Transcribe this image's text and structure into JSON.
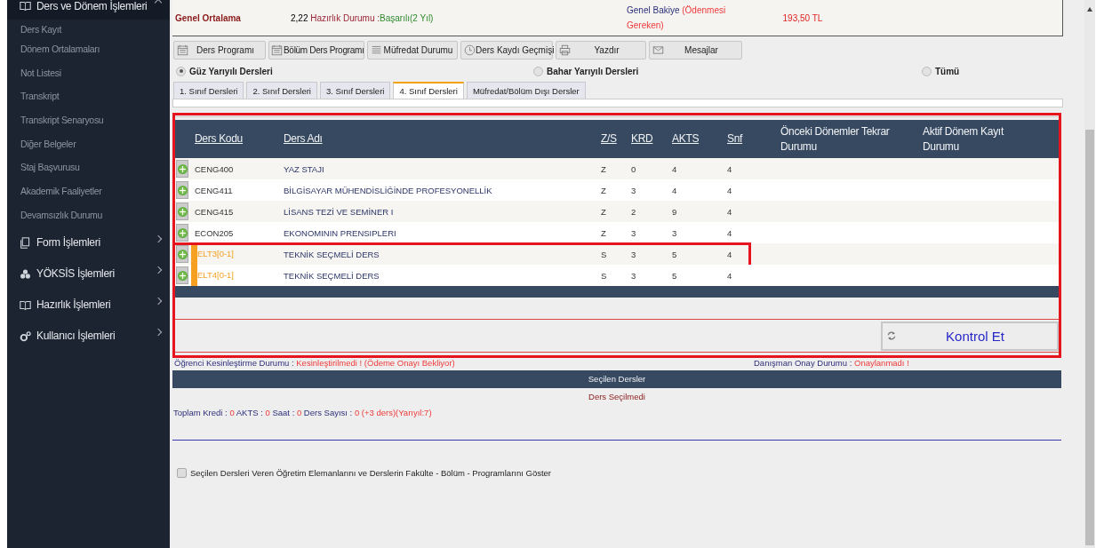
{
  "sidebar": {
    "groups": [
      {
        "label": "Ders ve Dönem İşlemleri",
        "expanded": true,
        "items": [
          "Ders Kayıt",
          "Dönem Ortalamaları",
          "Not Listesi",
          "Transkript",
          "Transkript Senaryosu",
          "Diğer Belgeler",
          "Staj Başvurusu",
          "Akademik Faaliyetler",
          "Devamsızlık Durumu"
        ]
      },
      {
        "label": "Form İşlemleri",
        "expanded": false
      },
      {
        "label": "YÖKSİS İşlemleri",
        "expanded": false
      },
      {
        "label": "Hazırlık İşlemleri",
        "expanded": false
      },
      {
        "label": "Kullanıcı İşlemleri",
        "expanded": false
      }
    ]
  },
  "summary": {
    "average_label": "Genel Ortalama",
    "average": "2,22",
    "prep_label": "Hazırlık Durumu :",
    "prep_value": "Başarılı(2 Yıl)",
    "balance_label": "Genel Bakiye",
    "balance_note": "(Ödenmesi Gereken)",
    "balance": "193,50 TL"
  },
  "toolbar": [
    {
      "label": "Ders Programı"
    },
    {
      "label": "Bölüm Ders Programı"
    },
    {
      "label": "Müfredat Durumu"
    },
    {
      "label": "Ders Kaydı Geçmişi"
    },
    {
      "label": "Yazdır"
    },
    {
      "label": "Mesajlar"
    }
  ],
  "semesters": [
    {
      "label": "Güz Yarıyılı Dersleri",
      "selected": true
    },
    {
      "label": "Bahar Yarıyılı Dersleri",
      "selected": false
    },
    {
      "label": "Tümü",
      "selected": false
    }
  ],
  "tabs": [
    {
      "label": "1. Sınıf Dersleri",
      "selected": false
    },
    {
      "label": "2. Sınıf Dersleri",
      "selected": false
    },
    {
      "label": "3. Sınıf Dersleri",
      "selected": false
    },
    {
      "label": "4. Sınıf Dersleri",
      "selected": true
    },
    {
      "label": "Müfredat/Bölüm Dışı Dersler",
      "selected": false
    }
  ],
  "table": {
    "framed": true,
    "columns": [
      "Ders Kodu",
      "Ders Adı",
      "Z/S",
      "KRD",
      "AKTS",
      "Snf",
      "Önceki Dönemler Tekrar Durumu",
      "Aktif Dönem Kayıt Durumu"
    ],
    "rows": [
      {
        "kind": "required",
        "highlighted": false,
        "cells": [
          "CENG400",
          "YAZ STAJI",
          "Z",
          "0",
          "4",
          "4"
        ]
      },
      {
        "kind": "required",
        "highlighted": false,
        "cells": [
          "CENG411",
          "BİLGİSAYAR MÜHENDİSLİĞİNDE PROFESYONELLİK",
          "Z",
          "3",
          "4",
          "4"
        ]
      },
      {
        "kind": "required",
        "highlighted": false,
        "cells": [
          "CENG415",
          "LİSANS TEZİ VE SEMİNER I",
          "Z",
          "2",
          "9",
          "4"
        ]
      },
      {
        "kind": "required",
        "highlighted": false,
        "cells": [
          "ECON205",
          "EKONOMININ PRENSIPLERI",
          "Z",
          "3",
          "3",
          "4"
        ]
      },
      {
        "kind": "elective",
        "highlighted": true,
        "cells": [
          "ELT3[0-1]",
          "TEKNİK SEÇMELİ DERS",
          "S",
          "3",
          "5",
          "4"
        ]
      },
      {
        "kind": "elective",
        "highlighted": false,
        "cells": [
          "ELT4[0-1]",
          "TEKNİK SEÇMELİ DERS",
          "S",
          "3",
          "5",
          "4"
        ]
      }
    ]
  },
  "check_button": "Kontrol Et",
  "status": {
    "student_label": "Öğrenci Kesinleştirme Durumu :",
    "student_value": "Kesinleştirilmedi !",
    "student_note": "(Ödeme Onayı Bekliyor)",
    "advisor_label": "Danışman Onay Durumu :",
    "advisor_value": "Onaylanmadı !"
  },
  "selected": {
    "title": "Seçilen Dersler",
    "empty": "Ders Seçilmedi"
  },
  "totals": [
    {
      "label": "Toplam Kredi :",
      "value": "0"
    },
    {
      "label": "AKTS :",
      "value": "0"
    },
    {
      "label": "Saat :",
      "value": "0"
    },
    {
      "label": "Ders Sayısı :",
      "value": "0 (+3 ders)(Yarıyıl:7)"
    }
  ],
  "show_staff": {
    "label": "Seçilen Dersleri Veren Öğretim Elemanlarını ve Derslerin Fakülte - Bölüm - Programlarını Göster",
    "checked": false
  }
}
